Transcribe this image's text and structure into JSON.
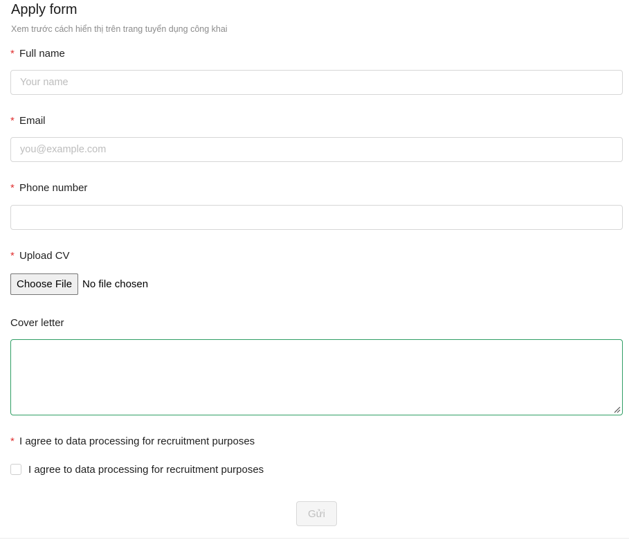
{
  "form": {
    "title": "Apply form",
    "subtitle": "Xem trước cách hiển thị trên trang tuyển dụng công khai",
    "required_mark": "*",
    "full_name": {
      "label": "Full name",
      "placeholder": "Your name",
      "value": ""
    },
    "email": {
      "label": "Email",
      "placeholder": "you@example.com",
      "value": ""
    },
    "phone": {
      "label": "Phone number",
      "placeholder": "",
      "value": ""
    },
    "upload_cv": {
      "label": "Upload CV",
      "button_label": "Choose File",
      "status": "No file chosen"
    },
    "cover_letter": {
      "label": "Cover letter",
      "value": ""
    },
    "consent": {
      "label": "I agree to data processing for recruitment purposes",
      "checkbox_label": "I agree to data processing for recruitment purposes",
      "checked": false
    },
    "submit_label": "Gửi"
  },
  "colors": {
    "required": "#e03131",
    "focus_border": "#2f9e64",
    "subtitle": "#8c8c8c",
    "disabled_text": "#bfbfbf"
  },
  "icons": {
    "resize_grip": "resize-grip-icon"
  }
}
